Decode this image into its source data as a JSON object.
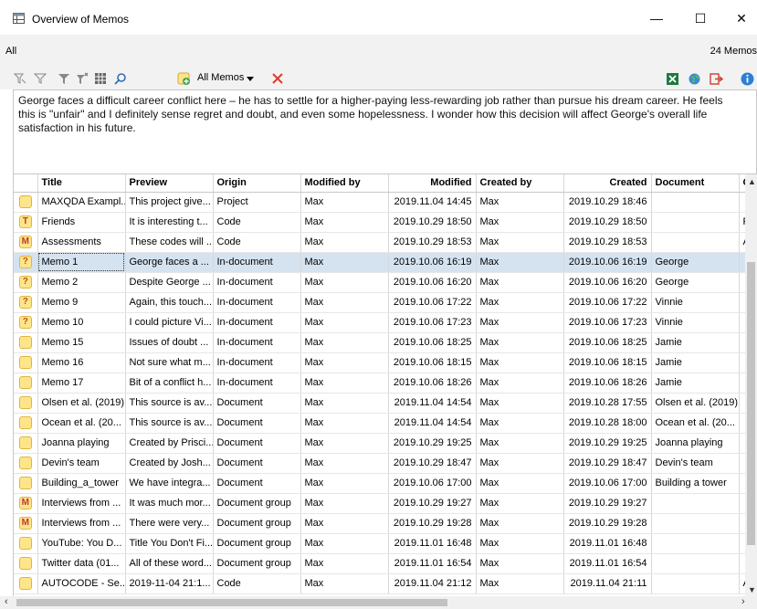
{
  "window": {
    "title": "Overview of Memos",
    "minimize": "—",
    "maximize": "☐",
    "close": "✕"
  },
  "info": {
    "filter": "All",
    "count": "24 Memos"
  },
  "toolbar": {
    "dropdown_label": "All Memos"
  },
  "memo_text": {
    "line1": "George faces a difficult career conflict here – he has to settle for a higher-paying less-rewarding job rather than pursue his dream career. He feels",
    "line2": "this is \"unfair\" and I definitely sense regret and doubt, and even some hopelessness. I wonder how this decision will affect George's overall life",
    "line3": "satisfaction in his future."
  },
  "table": {
    "columns": {
      "title": "Title",
      "preview": "Preview",
      "origin": "Origin",
      "modified_by": "Modified by",
      "modified": "Modified",
      "created_by": "Created by",
      "created": "Created",
      "document": "Document",
      "co": "Co"
    },
    "rows": [
      {
        "icon": "",
        "title": "MAXQDA Exampl...",
        "preview": "This project give...",
        "origin": "Project",
        "modified_by": "Max",
        "modified": "2019.11.04 14:45",
        "created_by": "Max",
        "created": "2019.10.29 18:46",
        "document": "",
        "co": ""
      },
      {
        "icon": "T",
        "title": "Friends",
        "preview": "It is interesting t...",
        "origin": "Code",
        "modified_by": "Max",
        "modified": "2019.10.29 18:50",
        "created_by": "Max",
        "created": "2019.10.29 18:50",
        "document": "",
        "co": "Frie"
      },
      {
        "icon": "M",
        "title": "Assessments",
        "preview": "These codes will ...",
        "origin": "Code",
        "modified_by": "Max",
        "modified": "2019.10.29 18:53",
        "created_by": "Max",
        "created": "2019.10.29 18:53",
        "document": "",
        "co": "Ass"
      },
      {
        "icon": "?",
        "title": "Memo 1",
        "preview": "George faces a ...",
        "origin": "In-document",
        "modified_by": "Max",
        "modified": "2019.10.06 16:19",
        "created_by": "Max",
        "created": "2019.10.06 16:19",
        "document": "George",
        "co": ""
      },
      {
        "icon": "?",
        "title": "Memo 2",
        "preview": "Despite George ...",
        "origin": "In-document",
        "modified_by": "Max",
        "modified": "2019.10.06 16:20",
        "created_by": "Max",
        "created": "2019.10.06 16:20",
        "document": "George",
        "co": ""
      },
      {
        "icon": "?",
        "title": "Memo 9",
        "preview": "Again, this touch...",
        "origin": "In-document",
        "modified_by": "Max",
        "modified": "2019.10.06 17:22",
        "created_by": "Max",
        "created": "2019.10.06 17:22",
        "document": "Vinnie",
        "co": ""
      },
      {
        "icon": "?",
        "title": "Memo 10",
        "preview": "I could picture Vi...",
        "origin": "In-document",
        "modified_by": "Max",
        "modified": "2019.10.06 17:23",
        "created_by": "Max",
        "created": "2019.10.06 17:23",
        "document": "Vinnie",
        "co": ""
      },
      {
        "icon": "",
        "title": "Memo 15",
        "preview": "Issues of doubt ...",
        "origin": "In-document",
        "modified_by": "Max",
        "modified": "2019.10.06 18:25",
        "created_by": "Max",
        "created": "2019.10.06 18:25",
        "document": "Jamie",
        "co": ""
      },
      {
        "icon": "",
        "title": "Memo 16",
        "preview": "Not sure what m...",
        "origin": "In-document",
        "modified_by": "Max",
        "modified": "2019.10.06 18:15",
        "created_by": "Max",
        "created": "2019.10.06 18:15",
        "document": "Jamie",
        "co": ""
      },
      {
        "icon": "",
        "title": "Memo 17",
        "preview": "Bit of a conflict h...",
        "origin": "In-document",
        "modified_by": "Max",
        "modified": "2019.10.06 18:26",
        "created_by": "Max",
        "created": "2019.10.06 18:26",
        "document": "Jamie",
        "co": ""
      },
      {
        "icon": "",
        "title": "Olsen et al. (2019)",
        "preview": "This source is av...",
        "origin": "Document",
        "modified_by": "Max",
        "modified": "2019.11.04 14:54",
        "created_by": "Max",
        "created": "2019.10.28 17:55",
        "document": "Olsen et al. (2019)",
        "co": ""
      },
      {
        "icon": "",
        "title": "Ocean et al. (20...",
        "preview": "This source is av...",
        "origin": "Document",
        "modified_by": "Max",
        "modified": "2019.11.04 14:54",
        "created_by": "Max",
        "created": "2019.10.28 18:00",
        "document": "Ocean et al. (20...",
        "co": ""
      },
      {
        "icon": "",
        "title": "Joanna playing",
        "preview": "Created by Prisci...",
        "origin": "Document",
        "modified_by": "Max",
        "modified": "2019.10.29 19:25",
        "created_by": "Max",
        "created": "2019.10.29 19:25",
        "document": "Joanna playing",
        "co": ""
      },
      {
        "icon": "",
        "title": "Devin's team",
        "preview": "Created by Josh...",
        "origin": "Document",
        "modified_by": "Max",
        "modified": "2019.10.29 18:47",
        "created_by": "Max",
        "created": "2019.10.29 18:47",
        "document": "Devin's team",
        "co": ""
      },
      {
        "icon": "",
        "title": "Building_a_tower",
        "preview": "We have integra...",
        "origin": "Document",
        "modified_by": "Max",
        "modified": "2019.10.06 17:00",
        "created_by": "Max",
        "created": "2019.10.06 17:00",
        "document": "Building a tower",
        "co": ""
      },
      {
        "icon": "M",
        "title": "Interviews from ...",
        "preview": "It was much mor...",
        "origin": "Document group",
        "modified_by": "Max",
        "modified": "2019.10.29 19:27",
        "created_by": "Max",
        "created": "2019.10.29 19:27",
        "document": "",
        "co": ""
      },
      {
        "icon": "M",
        "title": "Interviews from ...",
        "preview": "There were very...",
        "origin": "Document group",
        "modified_by": "Max",
        "modified": "2019.10.29 19:28",
        "created_by": "Max",
        "created": "2019.10.29 19:28",
        "document": "",
        "co": ""
      },
      {
        "icon": "",
        "title": "YouTube: You D...",
        "preview": "Title You Don't Fi...",
        "origin": "Document group",
        "modified_by": "Max",
        "modified": "2019.11.01 16:48",
        "created_by": "Max",
        "created": "2019.11.01 16:48",
        "document": "",
        "co": ""
      },
      {
        "icon": "",
        "title": "Twitter data (01...",
        "preview": "All of these word...",
        "origin": "Document group",
        "modified_by": "Max",
        "modified": "2019.11.01 16:54",
        "created_by": "Max",
        "created": "2019.11.01 16:54",
        "document": "",
        "co": ""
      },
      {
        "icon": "",
        "title": "AUTOCODE - Se...",
        "preview": "2019-11-04 21:1...",
        "origin": "Code",
        "modified_by": "Max",
        "modified": "2019.11.04 21:12",
        "created_by": "Max",
        "created": "2019.11.04 21:11",
        "document": "",
        "co": "AU"
      }
    ],
    "selected_row": 3
  }
}
